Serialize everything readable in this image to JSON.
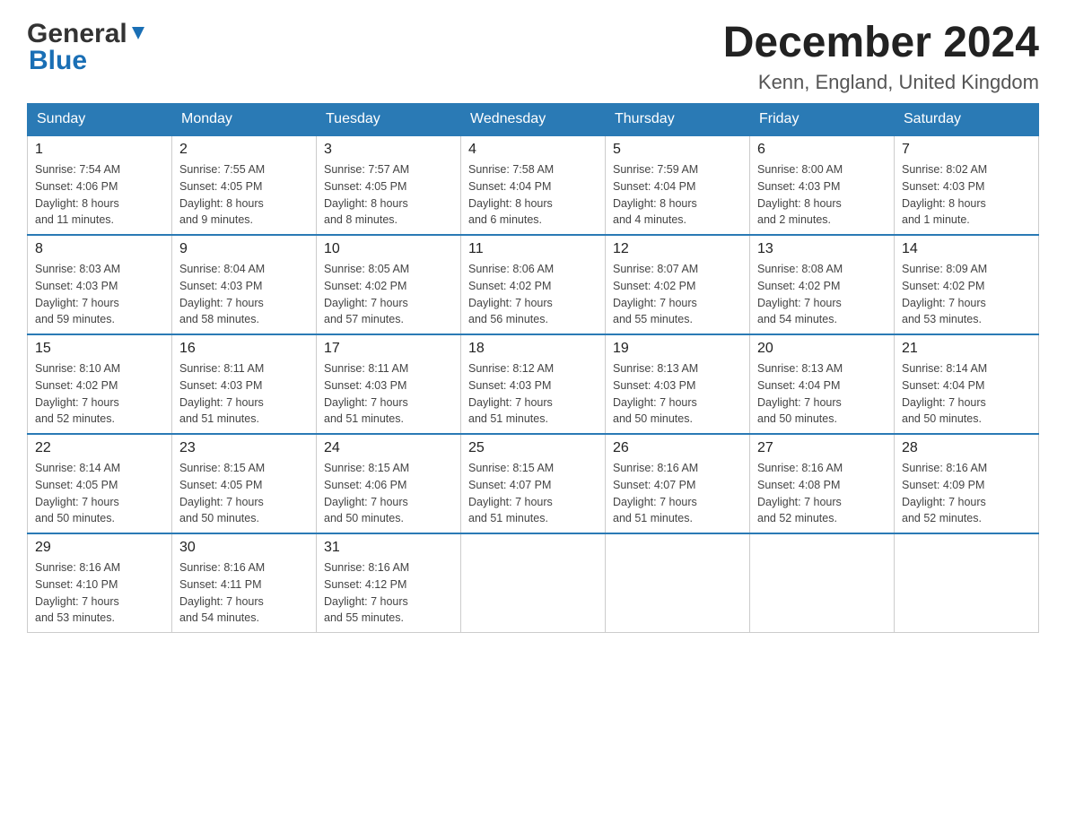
{
  "header": {
    "logo_general": "General",
    "logo_blue": "Blue",
    "month_year": "December 2024",
    "location": "Kenn, England, United Kingdom"
  },
  "weekdays": [
    "Sunday",
    "Monday",
    "Tuesday",
    "Wednesday",
    "Thursday",
    "Friday",
    "Saturday"
  ],
  "weeks": [
    [
      {
        "day": "1",
        "sunrise": "Sunrise: 7:54 AM",
        "sunset": "Sunset: 4:06 PM",
        "daylight": "Daylight: 8 hours",
        "daylight2": "and 11 minutes."
      },
      {
        "day": "2",
        "sunrise": "Sunrise: 7:55 AM",
        "sunset": "Sunset: 4:05 PM",
        "daylight": "Daylight: 8 hours",
        "daylight2": "and 9 minutes."
      },
      {
        "day": "3",
        "sunrise": "Sunrise: 7:57 AM",
        "sunset": "Sunset: 4:05 PM",
        "daylight": "Daylight: 8 hours",
        "daylight2": "and 8 minutes."
      },
      {
        "day": "4",
        "sunrise": "Sunrise: 7:58 AM",
        "sunset": "Sunset: 4:04 PM",
        "daylight": "Daylight: 8 hours",
        "daylight2": "and 6 minutes."
      },
      {
        "day": "5",
        "sunrise": "Sunrise: 7:59 AM",
        "sunset": "Sunset: 4:04 PM",
        "daylight": "Daylight: 8 hours",
        "daylight2": "and 4 minutes."
      },
      {
        "day": "6",
        "sunrise": "Sunrise: 8:00 AM",
        "sunset": "Sunset: 4:03 PM",
        "daylight": "Daylight: 8 hours",
        "daylight2": "and 2 minutes."
      },
      {
        "day": "7",
        "sunrise": "Sunrise: 8:02 AM",
        "sunset": "Sunset: 4:03 PM",
        "daylight": "Daylight: 8 hours",
        "daylight2": "and 1 minute."
      }
    ],
    [
      {
        "day": "8",
        "sunrise": "Sunrise: 8:03 AM",
        "sunset": "Sunset: 4:03 PM",
        "daylight": "Daylight: 7 hours",
        "daylight2": "and 59 minutes."
      },
      {
        "day": "9",
        "sunrise": "Sunrise: 8:04 AM",
        "sunset": "Sunset: 4:03 PM",
        "daylight": "Daylight: 7 hours",
        "daylight2": "and 58 minutes."
      },
      {
        "day": "10",
        "sunrise": "Sunrise: 8:05 AM",
        "sunset": "Sunset: 4:02 PM",
        "daylight": "Daylight: 7 hours",
        "daylight2": "and 57 minutes."
      },
      {
        "day": "11",
        "sunrise": "Sunrise: 8:06 AM",
        "sunset": "Sunset: 4:02 PM",
        "daylight": "Daylight: 7 hours",
        "daylight2": "and 56 minutes."
      },
      {
        "day": "12",
        "sunrise": "Sunrise: 8:07 AM",
        "sunset": "Sunset: 4:02 PM",
        "daylight": "Daylight: 7 hours",
        "daylight2": "and 55 minutes."
      },
      {
        "day": "13",
        "sunrise": "Sunrise: 8:08 AM",
        "sunset": "Sunset: 4:02 PM",
        "daylight": "Daylight: 7 hours",
        "daylight2": "and 54 minutes."
      },
      {
        "day": "14",
        "sunrise": "Sunrise: 8:09 AM",
        "sunset": "Sunset: 4:02 PM",
        "daylight": "Daylight: 7 hours",
        "daylight2": "and 53 minutes."
      }
    ],
    [
      {
        "day": "15",
        "sunrise": "Sunrise: 8:10 AM",
        "sunset": "Sunset: 4:02 PM",
        "daylight": "Daylight: 7 hours",
        "daylight2": "and 52 minutes."
      },
      {
        "day": "16",
        "sunrise": "Sunrise: 8:11 AM",
        "sunset": "Sunset: 4:03 PM",
        "daylight": "Daylight: 7 hours",
        "daylight2": "and 51 minutes."
      },
      {
        "day": "17",
        "sunrise": "Sunrise: 8:11 AM",
        "sunset": "Sunset: 4:03 PM",
        "daylight": "Daylight: 7 hours",
        "daylight2": "and 51 minutes."
      },
      {
        "day": "18",
        "sunrise": "Sunrise: 8:12 AM",
        "sunset": "Sunset: 4:03 PM",
        "daylight": "Daylight: 7 hours",
        "daylight2": "and 51 minutes."
      },
      {
        "day": "19",
        "sunrise": "Sunrise: 8:13 AM",
        "sunset": "Sunset: 4:03 PM",
        "daylight": "Daylight: 7 hours",
        "daylight2": "and 50 minutes."
      },
      {
        "day": "20",
        "sunrise": "Sunrise: 8:13 AM",
        "sunset": "Sunset: 4:04 PM",
        "daylight": "Daylight: 7 hours",
        "daylight2": "and 50 minutes."
      },
      {
        "day": "21",
        "sunrise": "Sunrise: 8:14 AM",
        "sunset": "Sunset: 4:04 PM",
        "daylight": "Daylight: 7 hours",
        "daylight2": "and 50 minutes."
      }
    ],
    [
      {
        "day": "22",
        "sunrise": "Sunrise: 8:14 AM",
        "sunset": "Sunset: 4:05 PM",
        "daylight": "Daylight: 7 hours",
        "daylight2": "and 50 minutes."
      },
      {
        "day": "23",
        "sunrise": "Sunrise: 8:15 AM",
        "sunset": "Sunset: 4:05 PM",
        "daylight": "Daylight: 7 hours",
        "daylight2": "and 50 minutes."
      },
      {
        "day": "24",
        "sunrise": "Sunrise: 8:15 AM",
        "sunset": "Sunset: 4:06 PM",
        "daylight": "Daylight: 7 hours",
        "daylight2": "and 50 minutes."
      },
      {
        "day": "25",
        "sunrise": "Sunrise: 8:15 AM",
        "sunset": "Sunset: 4:07 PM",
        "daylight": "Daylight: 7 hours",
        "daylight2": "and 51 minutes."
      },
      {
        "day": "26",
        "sunrise": "Sunrise: 8:16 AM",
        "sunset": "Sunset: 4:07 PM",
        "daylight": "Daylight: 7 hours",
        "daylight2": "and 51 minutes."
      },
      {
        "day": "27",
        "sunrise": "Sunrise: 8:16 AM",
        "sunset": "Sunset: 4:08 PM",
        "daylight": "Daylight: 7 hours",
        "daylight2": "and 52 minutes."
      },
      {
        "day": "28",
        "sunrise": "Sunrise: 8:16 AM",
        "sunset": "Sunset: 4:09 PM",
        "daylight": "Daylight: 7 hours",
        "daylight2": "and 52 minutes."
      }
    ],
    [
      {
        "day": "29",
        "sunrise": "Sunrise: 8:16 AM",
        "sunset": "Sunset: 4:10 PM",
        "daylight": "Daylight: 7 hours",
        "daylight2": "and 53 minutes."
      },
      {
        "day": "30",
        "sunrise": "Sunrise: 8:16 AM",
        "sunset": "Sunset: 4:11 PM",
        "daylight": "Daylight: 7 hours",
        "daylight2": "and 54 minutes."
      },
      {
        "day": "31",
        "sunrise": "Sunrise: 8:16 AM",
        "sunset": "Sunset: 4:12 PM",
        "daylight": "Daylight: 7 hours",
        "daylight2": "and 55 minutes."
      },
      null,
      null,
      null,
      null
    ]
  ]
}
